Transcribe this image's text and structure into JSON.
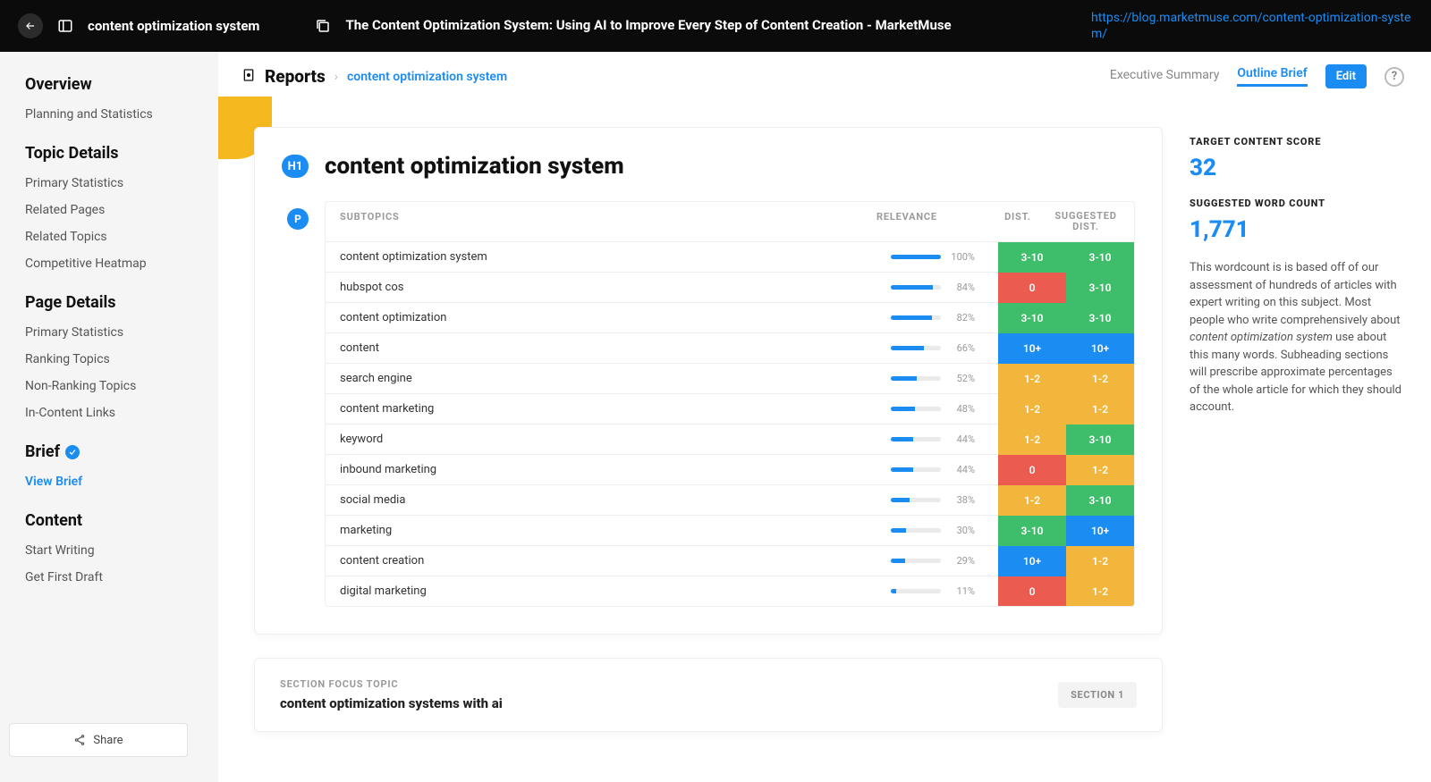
{
  "topbar": {
    "keyword": "content optimization system",
    "page_title": "The Content Optimization System: Using AI to Improve Every Step of Content Creation - MarketMuse",
    "url": "https://blog.marketmuse.com/content-optimization-system/"
  },
  "sidebar": {
    "overview": {
      "title": "Overview",
      "items": [
        "Planning and Statistics"
      ]
    },
    "topic_details": {
      "title": "Topic Details",
      "items": [
        "Primary Statistics",
        "Related Pages",
        "Related Topics",
        "Competitive Heatmap"
      ]
    },
    "page_details": {
      "title": "Page Details",
      "items": [
        "Primary Statistics",
        "Ranking Topics",
        "Non-Ranking Topics",
        "In-Content Links"
      ]
    },
    "brief": {
      "title": "Brief",
      "items": [
        "View Brief"
      ]
    },
    "content": {
      "title": "Content",
      "items": [
        "Start Writing",
        "Get First Draft"
      ]
    },
    "share_label": "Share"
  },
  "header": {
    "reports_label": "Reports",
    "crumb_current": "content optimization system",
    "tabs": {
      "executive": "Executive Summary",
      "outline": "Outline Brief"
    },
    "edit_label": "Edit"
  },
  "card": {
    "h1_badge": "H1",
    "p_badge": "P",
    "h1": "content optimization system",
    "table_headers": {
      "sub": "SUBTOPICS",
      "rel": "RELEVANCE",
      "d1": "DIST.",
      "d2": "SUGGESTED DIST."
    },
    "rows": [
      {
        "sub": "content optimization system",
        "rel": 100,
        "d1": "3-10",
        "d1c": "green",
        "d2": "3-10",
        "d2c": "green"
      },
      {
        "sub": "hubspot cos",
        "rel": 84,
        "d1": "0",
        "d1c": "red",
        "d2": "3-10",
        "d2c": "green"
      },
      {
        "sub": "content optimization",
        "rel": 82,
        "d1": "3-10",
        "d1c": "green",
        "d2": "3-10",
        "d2c": "green"
      },
      {
        "sub": "content",
        "rel": 66,
        "d1": "10+",
        "d1c": "blue",
        "d2": "10+",
        "d2c": "blue"
      },
      {
        "sub": "search engine",
        "rel": 52,
        "d1": "1-2",
        "d1c": "amber",
        "d2": "1-2",
        "d2c": "amber"
      },
      {
        "sub": "content marketing",
        "rel": 48,
        "d1": "1-2",
        "d1c": "amber",
        "d2": "1-2",
        "d2c": "amber"
      },
      {
        "sub": "keyword",
        "rel": 44,
        "d1": "1-2",
        "d1c": "amber",
        "d2": "3-10",
        "d2c": "green"
      },
      {
        "sub": "inbound marketing",
        "rel": 44,
        "d1": "0",
        "d1c": "red",
        "d2": "1-2",
        "d2c": "amber"
      },
      {
        "sub": "social media",
        "rel": 38,
        "d1": "1-2",
        "d1c": "amber",
        "d2": "3-10",
        "d2c": "green"
      },
      {
        "sub": "marketing",
        "rel": 30,
        "d1": "3-10",
        "d1c": "green",
        "d2": "10+",
        "d2c": "blue"
      },
      {
        "sub": "content creation",
        "rel": 29,
        "d1": "10+",
        "d1c": "blue",
        "d2": "1-2",
        "d2c": "amber"
      },
      {
        "sub": "digital marketing",
        "rel": 11,
        "d1": "0",
        "d1c": "red",
        "d2": "1-2",
        "d2c": "amber"
      }
    ]
  },
  "section": {
    "label": "SECTION FOCUS TOPIC",
    "title": "content optimization systems with ai",
    "number": "SECTION 1"
  },
  "aside": {
    "score_label": "TARGET CONTENT SCORE",
    "score_value": "32",
    "wc_label": "SUGGESTED WORD COUNT",
    "wc_value": "1,771",
    "desc_pre": "This wordcount is is based off of our assessment of hundreds of articles with expert writing on this subject. Most people who write comprehensively about ",
    "desc_em": "content optimization system",
    "desc_post": " use about this many words. Subheading sections will prescribe approximate percentages of the whole article for which they should account."
  }
}
